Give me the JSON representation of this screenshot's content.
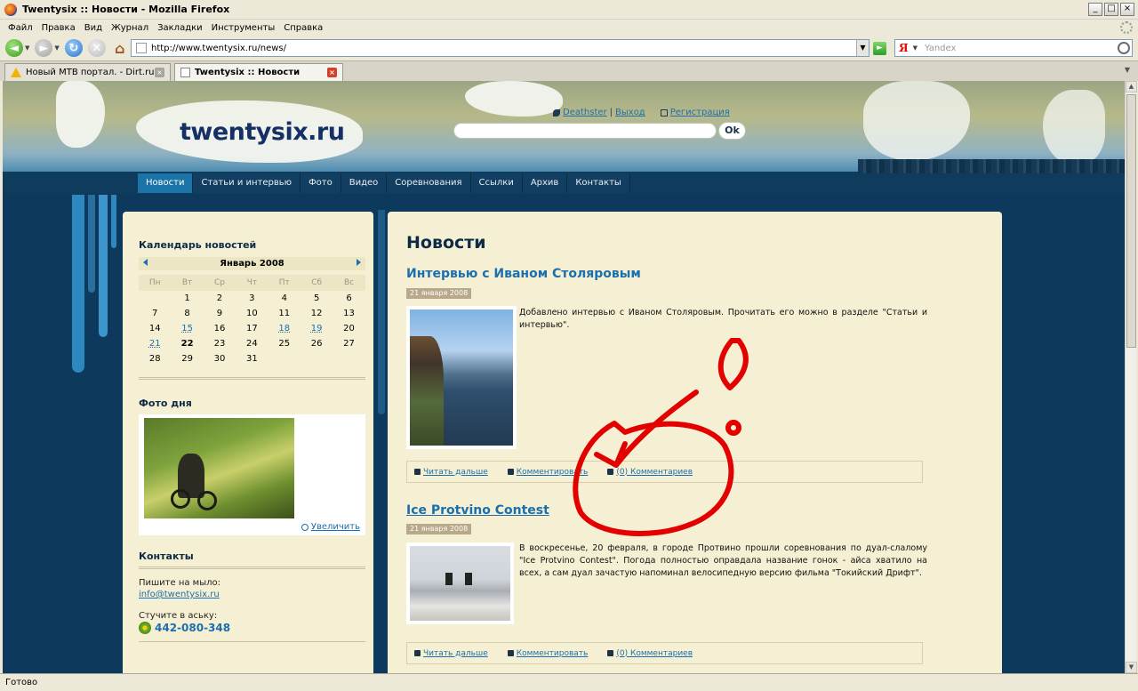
{
  "window": {
    "title": "Twentysix :: Новости - Mozilla Firefox",
    "min": "_",
    "max": "□",
    "close": "×"
  },
  "menu": [
    "Файл",
    "Правка",
    "Вид",
    "Журнал",
    "Закладки",
    "Инструменты",
    "Справка"
  ],
  "nav": {
    "url": "http://www.twentysix.ru/news/",
    "search_placeholder": "Yandex",
    "search_engine_glyph": "Я"
  },
  "tabs": [
    {
      "label": "Новый MTB портал. - Dirt.ru",
      "active": false
    },
    {
      "label": "Twentysix :: Новости",
      "active": true
    }
  ],
  "status": "Готово",
  "site": {
    "logo": "twentysix.ru",
    "user_name": "Deathster",
    "logout": "Выход",
    "register": "Регистрация",
    "search_value": "",
    "ok": "Ok",
    "menu": [
      "Новости",
      "Статьи и интервью",
      "Фото",
      "Видео",
      "Соревнования",
      "Ссылки",
      "Архив",
      "Контакты"
    ],
    "active_menu": "Новости"
  },
  "sidebar": {
    "calendar_title": "Календарь новостей",
    "month": "Январь 2008",
    "weekdays": [
      "Пн",
      "Вт",
      "Ср",
      "Чт",
      "Пт",
      "Сб",
      "Вс"
    ],
    "weeks": [
      [
        "",
        "1",
        "2",
        "3",
        "4",
        "5",
        "6"
      ],
      [
        "7",
        "8",
        "9",
        "10",
        "11",
        "12",
        "13"
      ],
      [
        "14",
        "15",
        "16",
        "17",
        "18",
        "19",
        "20"
      ],
      [
        "21",
        "22",
        "23",
        "24",
        "25",
        "26",
        "27"
      ],
      [
        "28",
        "29",
        "30",
        "31",
        "",
        "",
        ""
      ]
    ],
    "linked_days": [
      "15",
      "18",
      "19",
      "21"
    ],
    "today": "22",
    "photo_title": "Фото дня",
    "zoom": "Увеличить",
    "contacts_title": "Контакты",
    "email_label": "Пишите на мыло:",
    "email": "info@twentysix.ru",
    "icq_label": "Стучите в аську:",
    "icq": "442-080-348"
  },
  "main": {
    "heading": "Новости",
    "posts": [
      {
        "title": "Интервью с Иваном Столяровым",
        "date": "21 января 2008",
        "text": "Добавлено интервью с Иваном Столяровым. Прочитать его можно в разделе \"Статьи и интервью\".",
        "read_more": "Читать дальше",
        "comment": "Комментировать",
        "comments": "(0) Комментариев"
      },
      {
        "title": "Ice Protvino Contest",
        "date": "21 января 2008",
        "text": "В воскресенье, 20 февраля, в городе Протвино прошли соревнования по дуал-слалому \"Ice Protvino Contest\". Погода полностью оправдала название гонок - айса хватило на всех, а сам дуал зачастую напоминал велосипедную версию фильма \"Токийский Дрифт\".",
        "read_more": "Читать дальше",
        "comment": "Комментировать",
        "comments": "(0) Комментариев"
      }
    ]
  },
  "colors": {
    "header_dark": "#0f3b5c",
    "link": "#1b6fae",
    "panel": "#f5f0d3",
    "annotation": "#e30000"
  }
}
